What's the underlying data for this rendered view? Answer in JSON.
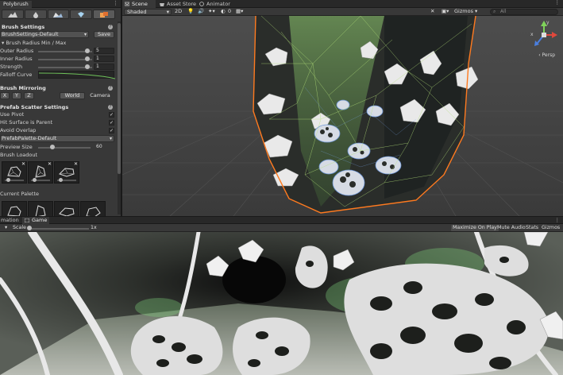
{
  "polybrush": {
    "tab_title": "Polybrush",
    "brush_settings": {
      "title": "Brush Settings",
      "preset": "BrushSettings-Default",
      "save_label": "Save",
      "radius_minmax_label": "Brush Radius Min / Max",
      "outer_radius": {
        "label": "Outer Radius",
        "value": "5",
        "fraction": 0.91
      },
      "inner_radius": {
        "label": "Inner Radius",
        "value": "1",
        "fraction": 0.91
      },
      "strength": {
        "label": "Strength",
        "value": "1",
        "fraction": 0.91
      },
      "falloff_label": "Falloff Curve"
    },
    "brush_mirroring": {
      "title": "Brush Mirroring",
      "x": "X",
      "y": "Y",
      "z": "Z",
      "world": "World",
      "camera": "Camera"
    },
    "prefab_scatter": {
      "title": "Prefab Scatter Settings",
      "use_pivot": {
        "label": "Use Pivot",
        "checked": true
      },
      "hit_surface": {
        "label": "Hit Surface is Parent",
        "checked": true
      },
      "avoid_overlap": {
        "label": "Avoid Overlap",
        "checked": true
      },
      "palette": "PrefabPalette-Default",
      "preview_size": {
        "label": "Preview Size",
        "value": "60",
        "fraction": 0.28
      },
      "brush_loadout_label": "Brush Loadout",
      "current_palette_label": "Current Palette"
    }
  },
  "scene": {
    "tabs": [
      {
        "label": "Scene",
        "active": true
      },
      {
        "label": "Asset Store",
        "active": false
      },
      {
        "label": "Animator",
        "active": false
      }
    ],
    "toolbar": {
      "shading": "Shaded",
      "mode_2d": "2D",
      "hidden_count": "0",
      "gizmos": "Gizmos",
      "search_placeholder": "All"
    },
    "projection": "Persp",
    "axis_y": "y",
    "axis_x": "x"
  },
  "game": {
    "tabs": [
      {
        "label": "mation",
        "active": false
      },
      {
        "label": "Game",
        "active": true
      }
    ],
    "toolbar": {
      "scale_label": "Scale",
      "scale_value": "1x",
      "maximize": "Maximize On Play",
      "mute": "Mute Audio",
      "stats": "Stats",
      "gizmos": "Gizmos"
    }
  },
  "colors": {
    "panel": "#383838",
    "selection_outline": "#ff7a1f",
    "wireframe": "#8bdc6a",
    "blue_wire": "#5aa0ff"
  },
  "icons": [
    "menu-icon",
    "paint-icon",
    "water-drop-icon",
    "mountain-icon",
    "gem-icon",
    "prefab-icon",
    "scene-icon",
    "asset-store-icon",
    "animator-icon",
    "light-icon",
    "audio-icon",
    "effects-icon",
    "camera-icon",
    "tools-icon",
    "search-icon",
    "game-icon"
  ]
}
